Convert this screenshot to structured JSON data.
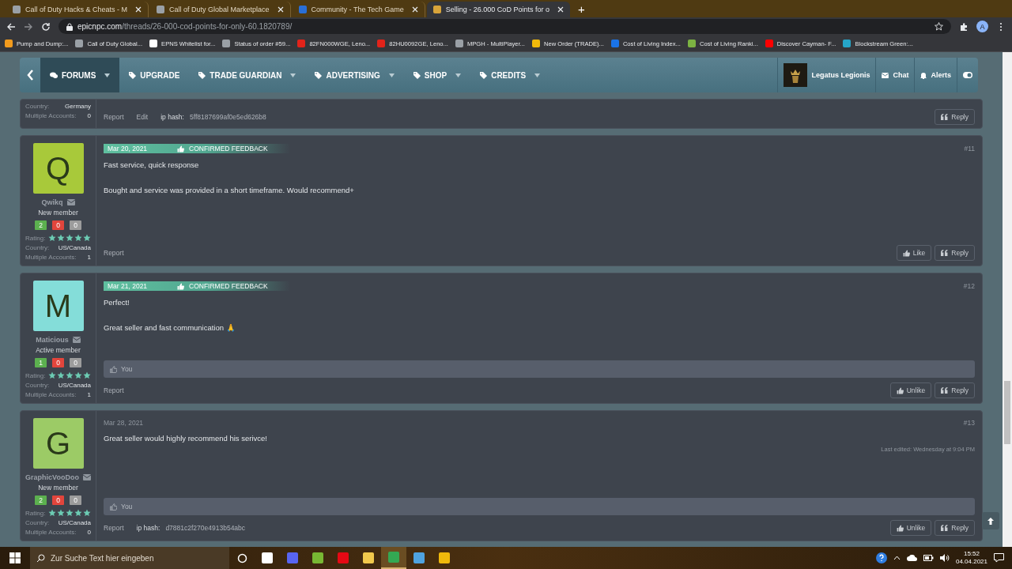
{
  "browser": {
    "tabs": [
      {
        "title": "Call of Duty Hacks & Cheats - M",
        "selected": false
      },
      {
        "title": "Call of Duty Global Marketplace",
        "selected": false
      },
      {
        "title": "Community - The Tech Game",
        "selected": false
      },
      {
        "title": "Selling - 26.000 CoD Points for o",
        "selected": true
      }
    ],
    "new_tab": "+",
    "url_host": "epicnpc.com",
    "url_path": "/threads/26-000-cod-points-for-only-60.1820789/",
    "profile": "A",
    "bookmarks": [
      "Pump and Dump:...",
      "Call of Duty Global...",
      "EPNS Whitelist for...",
      "Status of order #59...",
      "82FN000WGE, Leno...",
      "82HU0092GE, Leno...",
      "MPGH - MultiPlayer...",
      "New Order (TRADE)...",
      "Cost of Living Index...",
      "Cost of Living Ranki...",
      "Discover Cayman- F...",
      "Blockstream Green:..."
    ]
  },
  "nav": {
    "items": [
      {
        "label": "FORUMS",
        "selected": true
      },
      {
        "label": "UPGRADE",
        "selected": false
      },
      {
        "label": "TRADE GUARDIAN",
        "selected": false
      },
      {
        "label": "ADVERTISING",
        "selected": false
      },
      {
        "label": "SHOP",
        "selected": false
      },
      {
        "label": "CREDITS",
        "selected": false
      }
    ],
    "user": "Legatus Legionis",
    "links": [
      "Chat",
      "Alerts"
    ]
  },
  "posts": [
    {
      "kind": "partial",
      "info": [
        {
          "label": "Country:",
          "value": "Germany"
        },
        {
          "label": "Multiple Accounts:",
          "value": "0"
        }
      ],
      "links": [
        "Report",
        "Edit"
      ],
      "ip_hash": {
        "label": "ip hash:",
        "value": "5ff8187699af0e5ed626b8"
      },
      "actions": [
        {
          "kind": "reply",
          "label": "Reply"
        }
      ]
    },
    {
      "kind": "full",
      "avatar": {
        "letter": "Q",
        "color": "#a8c93a"
      },
      "name": "Qwikq",
      "title": "New member",
      "feedback": [
        {
          "kind": "positive",
          "count": "2"
        },
        {
          "kind": "negative",
          "count": "0"
        },
        {
          "kind": "neutral",
          "count": "0"
        }
      ],
      "rating_label": "Rating:",
      "stars": 5,
      "info": [
        {
          "label": "Country:",
          "value": "US/Canada"
        },
        {
          "label": "Multiple Accounts:",
          "value": "1"
        }
      ],
      "date": "Mar 20, 2021",
      "confirmed": true,
      "confirmed_label": "CONFIRMED FEEDBACK",
      "number": "#11",
      "paragraphs": [
        "Fast service, quick response",
        "Bought and service was provided in a short timeframe. Would recommend+"
      ],
      "links": [
        "Report"
      ],
      "actions": [
        {
          "kind": "like",
          "label": "Like"
        },
        {
          "kind": "reply",
          "label": "Reply"
        }
      ]
    },
    {
      "kind": "full",
      "avatar": {
        "letter": "M",
        "color": "#84ddd9"
      },
      "name": "Maticious",
      "title": "Active member",
      "feedback": [
        {
          "kind": "positive",
          "count": "1"
        },
        {
          "kind": "negative",
          "count": "0"
        },
        {
          "kind": "neutral",
          "count": "0"
        }
      ],
      "rating_label": "Rating:",
      "stars": 5,
      "info": [
        {
          "label": "Country:",
          "value": "US/Canada"
        },
        {
          "label": "Multiple Accounts:",
          "value": "1"
        }
      ],
      "date": "Mar 21, 2021",
      "confirmed": true,
      "confirmed_label": "CONFIRMED FEEDBACK",
      "number": "#12",
      "paragraphs": [
        "Perfect!",
        "Great seller and fast communication 🙏"
      ],
      "liked_by": "You",
      "links": [
        "Report"
      ],
      "actions": [
        {
          "kind": "unlike",
          "label": "Unlike"
        },
        {
          "kind": "reply",
          "label": "Reply"
        }
      ]
    },
    {
      "kind": "full",
      "avatar": {
        "letter": "G",
        "color": "#9ccb66"
      },
      "name": "GraphicVooDoo",
      "title": "New member",
      "feedback": [
        {
          "kind": "positive",
          "count": "2"
        },
        {
          "kind": "negative",
          "count": "0"
        },
        {
          "kind": "neutral",
          "count": "0"
        }
      ],
      "rating_label": "Rating:",
      "stars": 5,
      "info": [
        {
          "label": "Country:",
          "value": "US/Canada"
        },
        {
          "label": "Multiple Accounts:",
          "value": "0"
        }
      ],
      "date": "Mar 28, 2021",
      "confirmed": false,
      "number": "#13",
      "paragraphs": [
        "Great seller would highly recommend his serivce!"
      ],
      "edited": "Last edited: Wednesday at 9:04 PM",
      "liked_by": "You",
      "links": [
        "Report"
      ],
      "ip_hash": {
        "label": "ip hash:",
        "value": "d7881c2f270e4913b54abc"
      },
      "actions": [
        {
          "kind": "unlike",
          "label": "Unlike"
        },
        {
          "kind": "reply",
          "label": "Reply"
        }
      ]
    }
  ],
  "taskbar": {
    "search": {
      "placeholder": "Zur Suche Text hier eingeben"
    },
    "apps": [
      {
        "selected": false
      },
      {
        "selected": false
      },
      {
        "selected": false
      },
      {
        "selected": false
      },
      {
        "selected": false
      },
      {
        "selected": false
      },
      {
        "selected": true
      },
      {
        "selected": false
      },
      {
        "selected": false
      }
    ],
    "time": "15:52",
    "date": "04.04.2021"
  }
}
